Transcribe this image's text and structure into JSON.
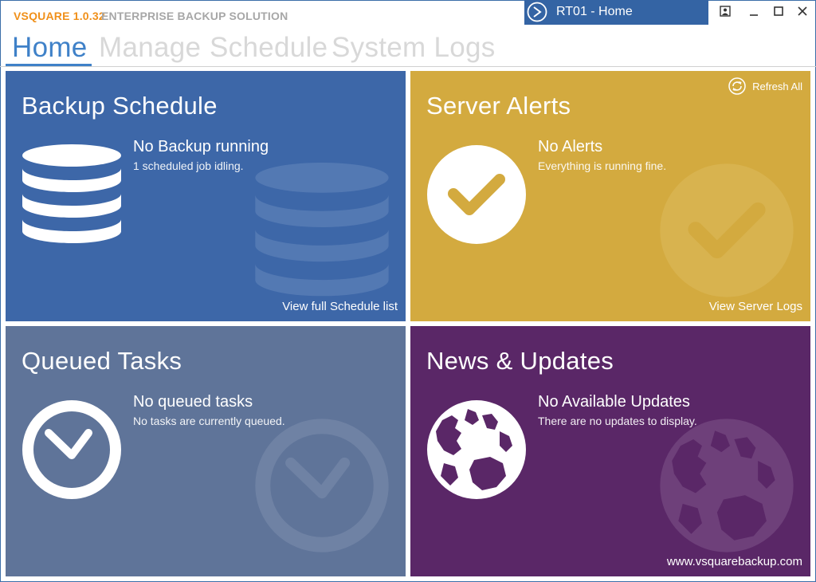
{
  "app": {
    "name": "VSQUARE 1.0.32",
    "subtitle": "ENTERPRISE BACKUP SOLUTION",
    "server_tab": "RT01 - Home"
  },
  "nav": {
    "tabs": [
      "Home",
      "Manage",
      "Schedule",
      "System Logs"
    ],
    "active": "Home"
  },
  "tiles": {
    "backup": {
      "title": "Backup Schedule",
      "headline": "No Backup running",
      "detail": "1 scheduled job idling.",
      "link": "View full Schedule list",
      "icon": "database-icon",
      "color": "#3d67a8"
    },
    "alerts": {
      "title": "Server Alerts",
      "headline": "No Alerts",
      "detail": "Everything is running fine.",
      "link": "View Server Logs",
      "refresh": "Refresh All",
      "icon": "check-circle-icon",
      "color": "#d3aa3f"
    },
    "queued": {
      "title": "Queued Tasks",
      "headline": "No queued tasks",
      "detail": "No tasks are currently queued.",
      "icon": "clock-icon",
      "color": "#5f7499"
    },
    "news": {
      "title": "News & Updates",
      "headline": "No Available Updates",
      "detail": "There are no updates to display.",
      "link": "www.vsquarebackup.com",
      "icon": "globe-icon",
      "color": "#5a2767"
    }
  },
  "colors": {
    "accent": "#3f81c8",
    "brand_orange": "#f0901a",
    "server_tab": "#3464a4"
  }
}
